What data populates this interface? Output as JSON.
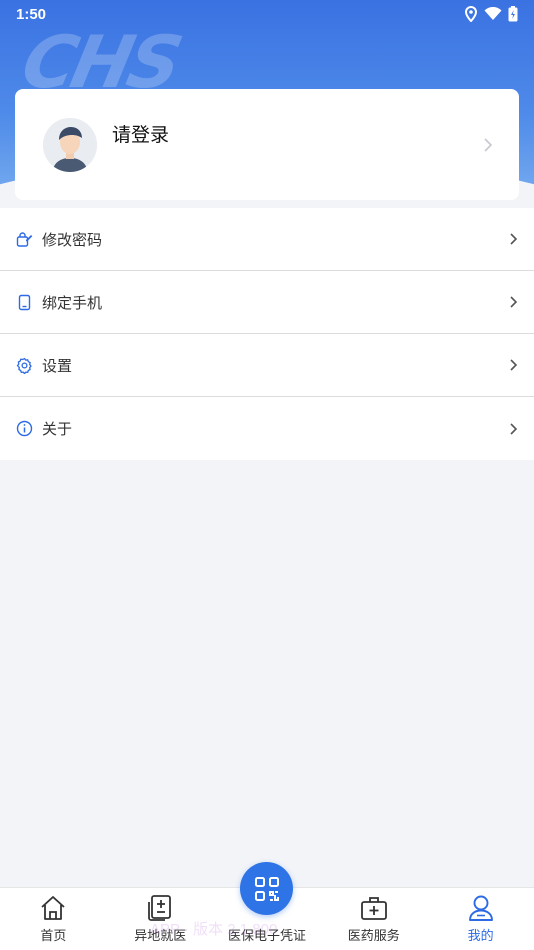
{
  "status_bar": {
    "time": "1:50"
  },
  "header": {
    "watermark": "CHS"
  },
  "profile": {
    "login_text": "请登录"
  },
  "menu": {
    "items": [
      {
        "label": "修改密码",
        "icon": "edit-lock-icon"
      },
      {
        "label": "绑定手机",
        "icon": "phone-icon"
      },
      {
        "label": "设置",
        "icon": "gear-icon"
      },
      {
        "label": "关于",
        "icon": "info-icon"
      }
    ]
  },
  "bottom_nav": {
    "items": [
      {
        "label": "首页",
        "icon": "home-icon",
        "active": false
      },
      {
        "label": "异地就医",
        "icon": "medical-record-icon",
        "active": false
      },
      {
        "label": "医保电子凭证",
        "icon": "qr-code-icon",
        "active": false
      },
      {
        "label": "医药服务",
        "icon": "medicine-kit-icon",
        "active": false
      },
      {
        "label": "我的",
        "icon": "user-icon",
        "active": true
      }
    ],
    "background_text": "APP · 版本 2.1.800"
  },
  "colors": {
    "accent": "#2d6be4",
    "header_top": "#3a72e2",
    "page_bg": "#f2f4f8"
  }
}
